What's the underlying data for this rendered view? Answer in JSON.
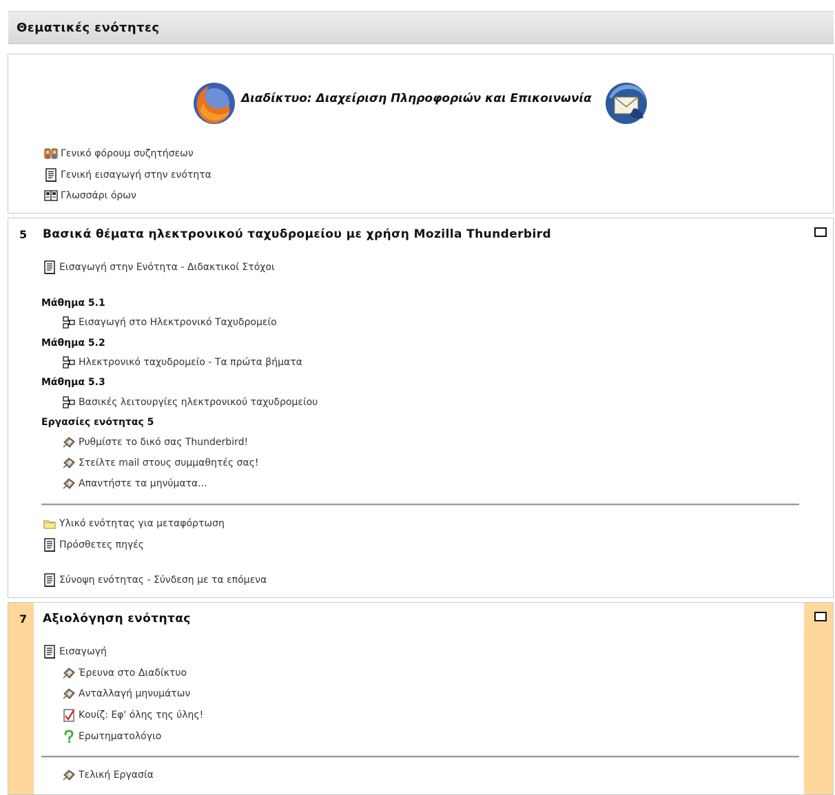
{
  "header": {
    "title": "Θεματικές ενότητες"
  },
  "section0": {
    "banner_text": "Διαδίκτυο: Διαχείριση Πληροφοριών και Επικοινωνία",
    "items": [
      {
        "label": "Γενικό φόρουμ συζητήσεων",
        "icon": "forum-icon"
      },
      {
        "label": "Γενική εισαγωγή στην ενότητα",
        "icon": "document-icon"
      },
      {
        "label": "Γλωσσάρι όρων",
        "icon": "glossary-icon"
      }
    ]
  },
  "section5": {
    "number": "5",
    "title": "Βασικά θέματα ηλεκτρονικού ταχυδρομείου με χρήση Mozilla Thunderbird",
    "intro": "Εισαγωγή στην Ενότητα - Διδακτικοί Στόχοι",
    "lessons": [
      {
        "heading": "Μάθημα 5.1",
        "item": "Εισαγωγή στο Ηλεκτρονικό Ταχυδρομείο"
      },
      {
        "heading": "Μάθημα 5.2",
        "item": "Ηλεκτρονικό ταχυδρομείο - Τα πρώτα βήματα"
      },
      {
        "heading": "Μάθημα 5.3",
        "item": "Βασικές λειτουργίες ηλεκτρονικού ταχυδρομείου"
      }
    ],
    "assignments_heading": "Εργασίες ενότητας 5",
    "assignments": [
      "Ρυθμίστε το δικό σας Thunderbird!",
      "Στείλτε mail στους συμμαθητές σας!",
      "Απαντήστε τα μηνύματα..."
    ],
    "bottom_items": [
      {
        "label": "Υλικό ενότητας για μεταφόρτωση",
        "icon": "folder-icon"
      },
      {
        "label": "Πρόσθετες πηγές",
        "icon": "document-icon"
      },
      {
        "label": "Σύνοψη ενότητας - Σύνδεση με τα επόμενα",
        "icon": "document-icon"
      }
    ]
  },
  "section7": {
    "number": "7",
    "title": "Αξιολόγηση ενότητας",
    "intro": "Εισαγωγή",
    "items": [
      {
        "label": "Έρευνα στο Διαδίκτυο",
        "icon": "assignment-icon"
      },
      {
        "label": "Ανταλλαγή μηνυμάτων",
        "icon": "assignment-icon"
      },
      {
        "label": "Κουίζ: Εφ' όλης της ύλης!",
        "icon": "quiz-icon"
      },
      {
        "label": "Ερωτηματολόγιο",
        "icon": "questionnaire-icon"
      }
    ],
    "final": "Τελική Εργασία"
  },
  "colors": {
    "header_bg": "#dddddd",
    "highlight": "#fdd89a",
    "border": "#c9c9c9"
  }
}
